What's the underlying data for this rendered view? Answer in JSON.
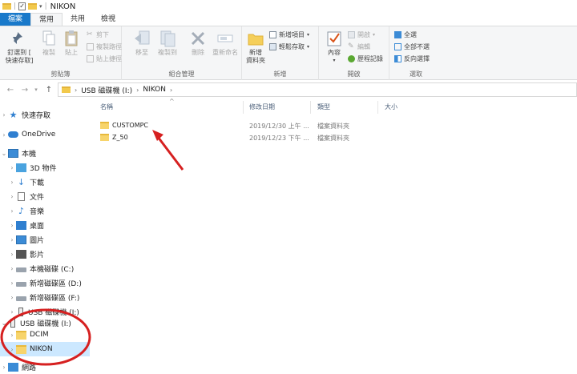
{
  "titlebar": {
    "title": "NIKON"
  },
  "tabs": [
    {
      "label": "檔案"
    },
    {
      "label": "常用"
    },
    {
      "label": "共用"
    },
    {
      "label": "檢視"
    }
  ],
  "ribbon": {
    "clipboard": {
      "label": "剪貼簿",
      "pin": "釘選到 [\n快速存取]",
      "copy": "複製",
      "paste": "貼上",
      "cut": "剪下",
      "copy_path": "複製路徑",
      "paste_shortcut": "貼上捷徑"
    },
    "organize": {
      "label": "組合管理",
      "move_to": "移至",
      "copy_to": "複製到",
      "delete": "刪除",
      "rename": "重新命名"
    },
    "new": {
      "label": "新增",
      "new_folder": "新增\n資料夾",
      "new_item": "新增項目",
      "easy_access": "輕鬆存取"
    },
    "open": {
      "label": "開啟",
      "properties": "內容",
      "open": "開啟",
      "edit": "編輯",
      "history": "歷程記錄"
    },
    "select": {
      "label": "選取",
      "select_all": "全選",
      "select_none": "全部不選",
      "invert": "反向選擇"
    }
  },
  "address": {
    "segments": [
      "USB 磁碟機 (I:)",
      "NIKON"
    ]
  },
  "sidebar": {
    "items": [
      {
        "label": "快速存取"
      },
      {
        "label": "OneDrive"
      },
      {
        "label": "本機"
      },
      {
        "label": "3D 物件"
      },
      {
        "label": "下載"
      },
      {
        "label": "文件"
      },
      {
        "label": "音樂"
      },
      {
        "label": "桌面"
      },
      {
        "label": "圖片"
      },
      {
        "label": "影片"
      },
      {
        "label": "本機磁碟 (C:)"
      },
      {
        "label": "新增磁碟區 (D:)"
      },
      {
        "label": "新增磁碟區 (F:)"
      },
      {
        "label": "USB 磁碟機 (I:)"
      },
      {
        "label": "USB 磁碟機 (I:)"
      },
      {
        "label": "DCIM"
      },
      {
        "label": "NIKON"
      },
      {
        "label": "網路"
      }
    ]
  },
  "columns": {
    "name": "名稱",
    "modified": "修改日期",
    "type": "類型",
    "size": "大小"
  },
  "files": [
    {
      "name": "CUSTOMPC",
      "modified": "2019/12/30 上午 ...",
      "type": "檔案資料夾",
      "size": ""
    },
    {
      "name": "Z_50",
      "modified": "2019/12/23 下午 ...",
      "type": "檔案資料夾",
      "size": ""
    }
  ],
  "colors": {
    "file_tab": "#1979ca",
    "selected": "#cce8ff",
    "annotation": "#d62020"
  }
}
